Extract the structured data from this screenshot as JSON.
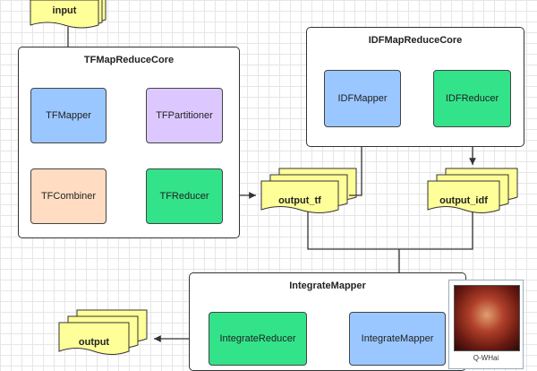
{
  "diagram": {
    "groups": {
      "tf_core": "TFMapReduceCore",
      "idf_core": "IDFMapReduceCore",
      "integrate": "IntegrateMapper"
    },
    "nodes": {
      "tf_mapper": "TFMapper",
      "tf_combiner": "TFCombiner",
      "tf_partitioner": "TFPartitioner",
      "tf_reducer": "TFReducer",
      "idf_mapper": "IDFMapper",
      "idf_reducer": "IDFReducer",
      "integrate_mapper": "IntegrateMapper",
      "integrate_reducer": "IntegrateReducer"
    },
    "documents": {
      "input": "input",
      "output_tf": "output_tf",
      "output_idf": "output_idf",
      "output": "output"
    },
    "colors": {
      "mapper": "#9ac7ff",
      "reducer": "#33e38a",
      "combiner": "#ffdcc2",
      "partitioner": "#dcc8ff",
      "document": "#ffff99"
    }
  },
  "watermark": {
    "caption": "Q-WHai"
  }
}
